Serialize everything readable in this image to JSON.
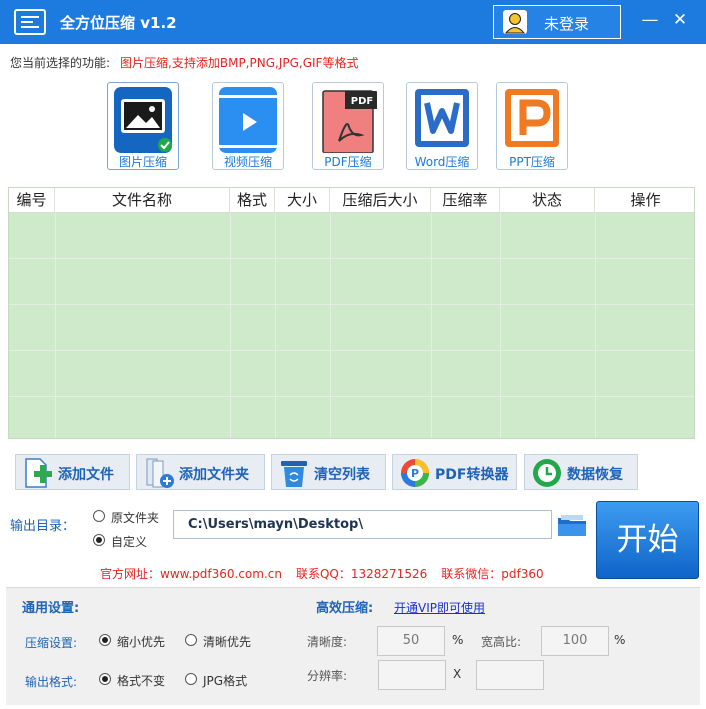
{
  "window": {
    "title": "全方位压缩 v1.2",
    "login_label": "未登录",
    "minimize_glyph": "—",
    "close_glyph": "✕"
  },
  "function_row": {
    "label": "您当前选择的功能:",
    "value": "图片压缩,支持添加BMP,PNG,JPG,GIF等格式"
  },
  "function_tiles": [
    {
      "label": "图片压缩",
      "icon": "image-compress-icon",
      "selected": true
    },
    {
      "label": "视频压缩",
      "icon": "video-compress-icon"
    },
    {
      "label": "PDF压缩",
      "icon": "pdf-compress-icon"
    },
    {
      "label": "Word压缩",
      "icon": "word-compress-icon"
    },
    {
      "label": "PPT压缩",
      "icon": "ppt-compress-icon"
    }
  ],
  "file_table": {
    "columns": [
      "编号",
      "文件名称",
      "格式",
      "大小",
      "压缩后大小",
      "压缩率",
      "状态",
      "操作"
    ],
    "rows": []
  },
  "toolbar": [
    {
      "label": "添加文件",
      "icon": "add-file-icon"
    },
    {
      "label": "添加文件夹",
      "icon": "add-folder-icon"
    },
    {
      "label": "清空列表",
      "icon": "trash-icon"
    },
    {
      "label": "PDF转换器",
      "icon": "pdf-converter-icon"
    },
    {
      "label": "数据恢复",
      "icon": "data-recovery-icon"
    }
  ],
  "output": {
    "label": "输出目录：",
    "option_original": "原文件夹",
    "option_custom": "自定义",
    "selected": "自定义",
    "path": "C:\\Users\\mayn\\Desktop\\",
    "start_label": "开始"
  },
  "contact": {
    "website": "官方网址：www.pdf360.com.cn",
    "qq": "联系QQ：1328271526",
    "wechat": "联系微信：pdf360"
  },
  "settings": {
    "general_title": "通用设置:",
    "compress_label": "压缩设置:",
    "compress_small": "缩小优先",
    "compress_clear": "清晰优先",
    "compress_selected": "缩小优先",
    "format_label": "输出格式:",
    "format_keep": "格式不变",
    "format_jpg": "JPG格式",
    "format_selected": "格式不变",
    "efficient_title": "高效压缩:",
    "vip_link": "开通VIP即可使用",
    "clarity_label": "清晰度:",
    "clarity_value": "50",
    "clarity_unit": "%",
    "ratio_label": "宽高比:",
    "ratio_value": "100",
    "ratio_unit": "%",
    "resolution_label": "分辨率:",
    "resolution_x": "",
    "resolution_sep": "X",
    "resolution_y": ""
  },
  "colors": {
    "titlebar": "#1d7be0",
    "accent_blue": "#1f63b8",
    "highlight_red": "#e8231f",
    "table_green": "#cfe9cb"
  }
}
